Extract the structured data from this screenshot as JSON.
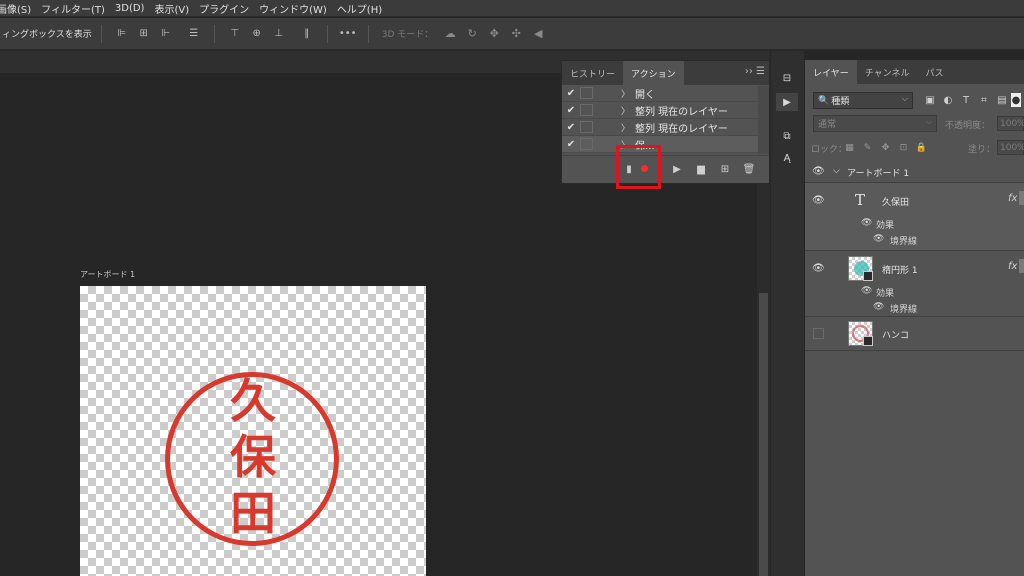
{
  "menu": [
    "画像(S)",
    "フィルター(T)",
    "3D(D)",
    "表示(V)",
    "プラグイン",
    "ウィンドウ(W)",
    "ヘルプ(H)"
  ],
  "options_bar": {
    "bounding_box_label": "ィングボックスを表示",
    "more_label": "•••",
    "mode_3d_label": "3D モード："
  },
  "document": {
    "artboard_label": "アートボード 1",
    "hanko_chars": [
      "久",
      "保",
      "田"
    ],
    "hanko_color": "#d9382d"
  },
  "actions_panel": {
    "tabs": [
      "ヒストリー",
      "アクション"
    ],
    "rows": [
      {
        "checked": true,
        "label": "開く"
      },
      {
        "checked": true,
        "label": "整列  現在のレイヤー"
      },
      {
        "checked": true,
        "label": "整列  現在のレイヤー"
      },
      {
        "checked": true,
        "label": "保..."
      }
    ],
    "record_highlight_color": "#e1141e"
  },
  "layers_panel": {
    "tabs": [
      "レイヤー",
      "チャンネル",
      "パス"
    ],
    "filter_kind": "種類",
    "blend_mode": "通常",
    "opacity_label": "不透明度：",
    "opacity_value": "100%",
    "lock_label": "ロック：",
    "fill_label": "塗り：",
    "fill_value": "100%",
    "artboard_group": "アートボード 1",
    "layers": [
      {
        "name": "久保田",
        "kind": "text",
        "fx": "fx",
        "effects_label": "効果",
        "effect": "境界線"
      },
      {
        "name": "楕円形 1",
        "kind": "shape",
        "fx": "fx",
        "effects_label": "効果",
        "effect": "境界線"
      },
      {
        "name": "ハンコ",
        "kind": "smart"
      }
    ]
  }
}
